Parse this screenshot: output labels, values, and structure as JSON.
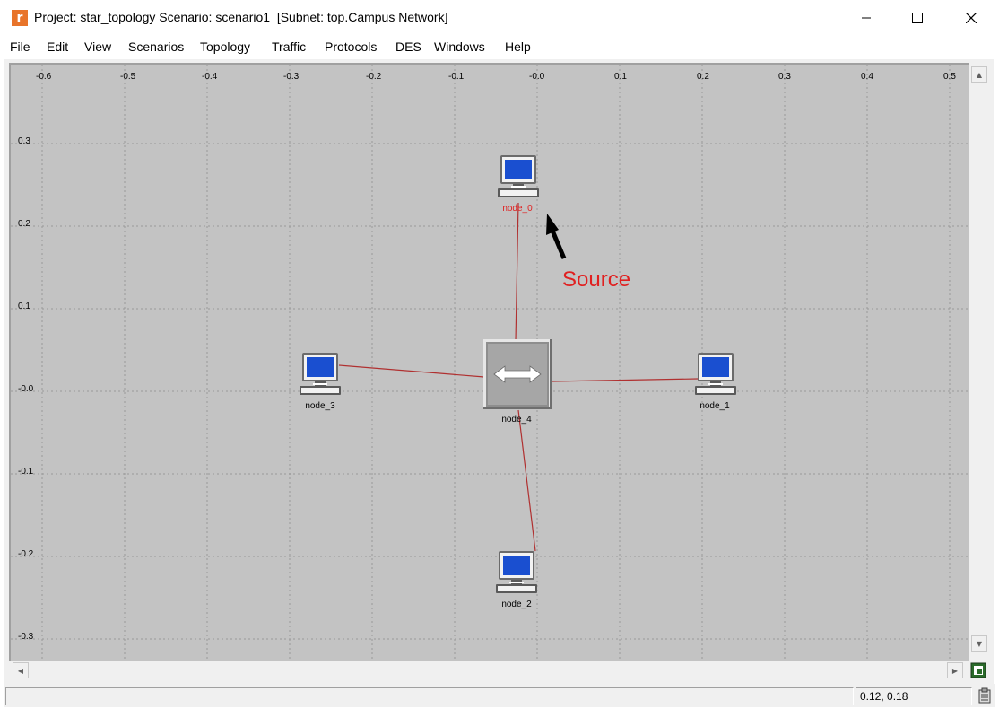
{
  "window": {
    "title": "Project: star_topology Scenario: scenario1  [Subnet: top.Campus Network]",
    "app_icon": "r",
    "controls": [
      "minimize-icon",
      "maximize-icon",
      "close-icon"
    ]
  },
  "menu": [
    "File",
    "Edit",
    "View",
    "Scenarios",
    "Topology",
    "Traffic",
    "Protocols",
    "DES",
    "Windows",
    "Help"
  ],
  "axes": {
    "x_ticks": [
      "-0.6",
      "-0.5",
      "-0.4",
      "-0.3",
      "-0.2",
      "-0.1",
      "-0.0",
      "0.1",
      "0.2",
      "0.3",
      "0.4",
      "0.5"
    ],
    "y_ticks": [
      "0.3",
      "0.2",
      "0.1",
      "-0.0",
      "-0.1",
      "-0.2",
      "-0.3"
    ]
  },
  "nodes": [
    {
      "id": "node_0",
      "label": "node_0",
      "type": "workstation",
      "label_color": "#e02020"
    },
    {
      "id": "node_1",
      "label": "node_1",
      "type": "workstation",
      "label_color": "#000000"
    },
    {
      "id": "node_2",
      "label": "node_2",
      "type": "workstation",
      "label_color": "#000000"
    },
    {
      "id": "node_3",
      "label": "node_3",
      "type": "workstation",
      "label_color": "#000000"
    },
    {
      "id": "node_4",
      "label": "node_4",
      "type": "switch",
      "label_color": "#000000"
    }
  ],
  "links": [
    {
      "from": "node_4",
      "to": "node_0"
    },
    {
      "from": "node_4",
      "to": "node_1"
    },
    {
      "from": "node_4",
      "to": "node_2"
    },
    {
      "from": "node_4",
      "to": "node_3"
    }
  ],
  "annotation": {
    "text": "Source",
    "color": "#e02020",
    "icon": "arrow-icon"
  },
  "colors": {
    "link": "#b03030",
    "canvas": "#c3c3c3",
    "screen": "#1a4fd0"
  },
  "status": {
    "coordinates": "0.12, 0.18"
  }
}
